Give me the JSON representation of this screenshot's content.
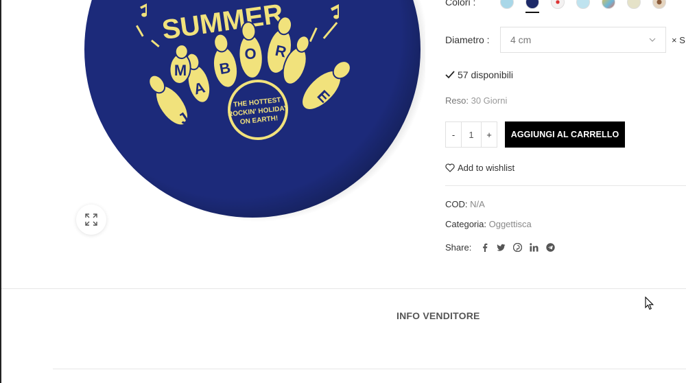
{
  "product": {
    "image_alt": "Summer Jamboree badge",
    "badge_text": {
      "headline": "SUMMER",
      "letters": [
        "J",
        "A",
        "M",
        "B",
        "O",
        "R",
        "E",
        "E"
      ],
      "tagline_1": "THE HOTTEST",
      "tagline_2": "ROCKIN' HOLIDAY",
      "tagline_3": "ON EARTH!"
    },
    "colors": {
      "badge_blue": "#1c2a7a",
      "badge_yellow": "#f1e27c"
    }
  },
  "variations": {
    "colors_label": "Colori :",
    "swatches": [
      {
        "name": "light-blue",
        "color": "#a9d7e8"
      },
      {
        "name": "dark-navy",
        "color": "#1d2a68"
      },
      {
        "name": "white-red",
        "color": "#f4f2f2"
      },
      {
        "name": "sky-blue",
        "color": "#bfe3ef"
      },
      {
        "name": "multicolor",
        "color": "#6cb6d8"
      },
      {
        "name": "cream",
        "color": "#e5e2c8"
      },
      {
        "name": "tan",
        "color": "#e4d4bf"
      }
    ],
    "diameter_label": "Diametro :",
    "diameter_value": "4 cm",
    "clear_label": "× S"
  },
  "stock": {
    "text": "57 disponibili"
  },
  "return": {
    "label": "Reso:",
    "value": "30 Giorni"
  },
  "cart": {
    "minus": "-",
    "quantity": "1",
    "plus": "+",
    "add_label": "AGGIUNGI AL CARRELLO"
  },
  "wishlist": {
    "label": "Add to wishlist"
  },
  "meta": {
    "sku_label": "COD:",
    "sku_value": "N/A",
    "category_label": "Categoria:",
    "category_value": "Oggettisca",
    "share_label": "Share:",
    "share_icons": [
      "facebook-icon",
      "twitter-icon",
      "pinterest-icon",
      "linkedin-icon",
      "telegram-icon"
    ]
  },
  "tabs": {
    "vendor_info": "INFO VENDITORE"
  }
}
